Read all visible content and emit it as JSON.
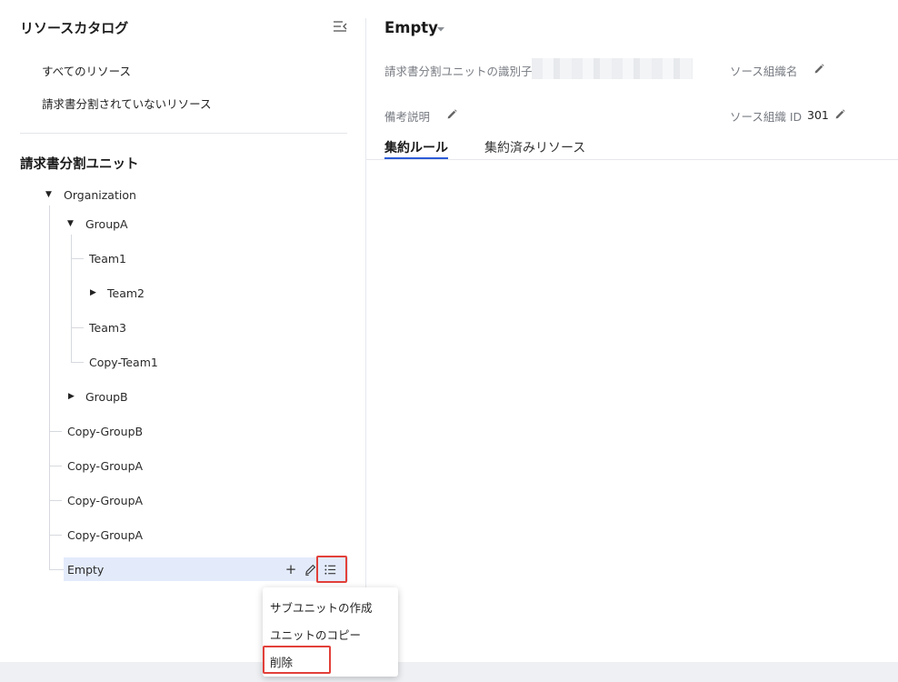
{
  "sidebar": {
    "title": "リソースカタログ",
    "nav_items": [
      "すべてのリソース",
      "請求書分割されていないリソース"
    ],
    "section_title": "請求書分割ユニット",
    "tree": {
      "root": "Organization",
      "group_a": "GroupA",
      "team1": "Team1",
      "team2": "Team2",
      "team3": "Team3",
      "copy_team1": "Copy-Team1",
      "group_b": "GroupB",
      "copy_group_b": "Copy-GroupB",
      "copy_group_a_1": "Copy-GroupA",
      "copy_group_a_2": "Copy-GroupA",
      "copy_group_a_3": "Copy-GroupA",
      "empty": "Empty"
    },
    "row_actions": {
      "add": "+"
    }
  },
  "context_menu": {
    "items": [
      "サブユニットの作成",
      "ユニットのコピー",
      "削除"
    ]
  },
  "detail": {
    "title": "Empty",
    "identifier_label": "請求書分割ユニットの識別子",
    "resource_group_name_label": "ソース組織名",
    "remarks_label": "備考説明",
    "resource_group_id_label": "ソース組織 ID",
    "resource_group_id_value": "301",
    "tabs": [
      "集約ルール",
      "集約済みリソース"
    ]
  },
  "colors": {
    "accent": "#2b5bd7",
    "highlight_box": "#e2403a",
    "selected_row": "#e3ebfb"
  }
}
